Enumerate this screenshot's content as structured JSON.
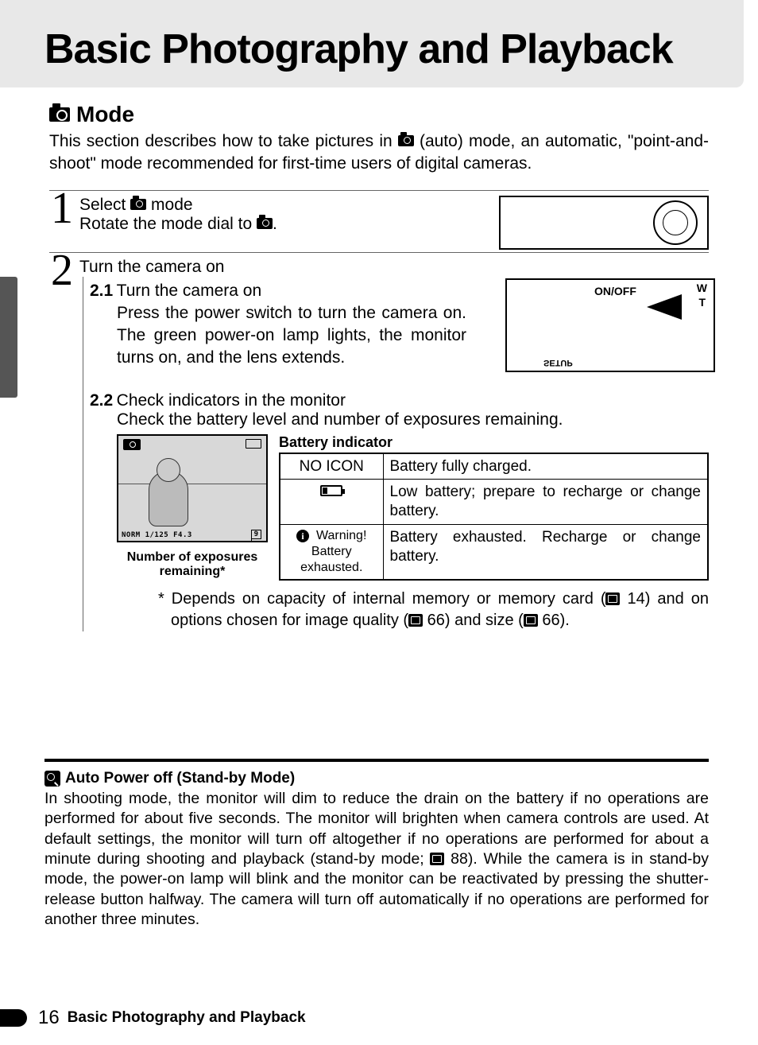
{
  "header": {
    "title": "Basic Photography and Playback"
  },
  "mode": {
    "heading": "Mode",
    "intro_a": "This section describes how to take pictures in ",
    "intro_b": " (auto) mode, an automatic, \"point-and-shoot\" mode recommended for first-time users of digital cameras."
  },
  "step1": {
    "num": "1",
    "title_a": "Select ",
    "title_b": " mode",
    "text_a": "Rotate the mode dial to ",
    "text_b": "."
  },
  "step2": {
    "num": "2",
    "title": "Turn the camera on",
    "sub1": {
      "label": "2.1",
      "title": "Turn the camera on",
      "text": "Press the power switch to turn the camera on.  The green power-on lamp lights, the monitor turns on, and the lens extends.",
      "img_onoff": "ON/OFF",
      "img_setup": "SETUP",
      "img_w": "W",
      "img_t": "T"
    },
    "sub2": {
      "label": "2.2",
      "title": "Check indicators in the monitor",
      "lead": "Check the battery level and number of exposures remaining.",
      "monitor_bottom": "NORM 1/125   F4.3",
      "monitor_count": "9",
      "monitor_caption_a": "Number of exposures",
      "monitor_caption_b": "remaining",
      "monitor_caption_ast": "*",
      "table_title": "Battery indicator",
      "rows": [
        {
          "c1": "NO ICON",
          "c2": "Battery fully charged."
        },
        {
          "c1": "low-battery-icon",
          "c2": "Low battery; prepare to recharge or change battery."
        },
        {
          "c1_warn_a": "Warning!",
          "c1_warn_b": "Battery exhausted.",
          "c2": "Battery exhausted.  Recharge or change battery."
        }
      ],
      "footnote_a": "* Depends on capacity of internal memory or memory card (",
      "footnote_b": " 14) and on options chosen for image quality (",
      "footnote_c": " 66) and size (",
      "footnote_d": " 66)."
    }
  },
  "note": {
    "heading": "Auto Power off (Stand-by Mode)",
    "body_a": "In shooting mode, the monitor will dim to reduce the drain on the battery if no operations are performed for about five seconds.  The monitor will brighten when camera controls are used.  At default settings, the monitor will turn off altogether if no operations are performed for about a minute during shooting and playback (stand-by mode; ",
    "body_b": " 88).  While the camera is in stand-by mode, the power-on lamp will blink and the monitor can be reactivated by pressing the shutter-release button halfway.  The camera will turn off automatically if no operations are performed for another three minutes."
  },
  "footer": {
    "page": "16",
    "title": "Basic Photography and Playback"
  }
}
